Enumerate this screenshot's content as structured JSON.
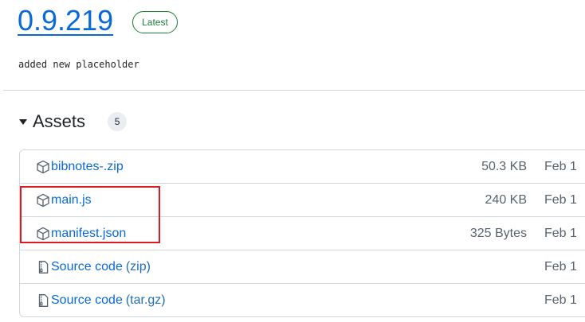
{
  "release": {
    "version": "0.9.219",
    "badge": "Latest",
    "notes": "added new placeholder"
  },
  "assets": {
    "title": "Assets",
    "count": "5",
    "items": [
      {
        "name": "bibnotes-.zip",
        "suffix": "",
        "size": "50.3 KB",
        "date": "Feb 1",
        "icon": "package-icon"
      },
      {
        "name": "main.js",
        "suffix": "",
        "size": "240 KB",
        "date": "Feb 1",
        "icon": "package-icon"
      },
      {
        "name": "manifest.json",
        "suffix": "",
        "size": "325 Bytes",
        "date": "Feb 1",
        "icon": "package-icon"
      },
      {
        "name": "Source code",
        "suffix": "(zip)",
        "size": "",
        "date": "Feb 1",
        "icon": "file-zip-icon"
      },
      {
        "name": "Source code",
        "suffix": "(tar.gz)",
        "size": "",
        "date": "Feb 1",
        "icon": "file-zip-icon"
      }
    ]
  },
  "colors": {
    "link": "#0969da",
    "latest": "#1a7f37",
    "highlight": "#e0181f"
  }
}
